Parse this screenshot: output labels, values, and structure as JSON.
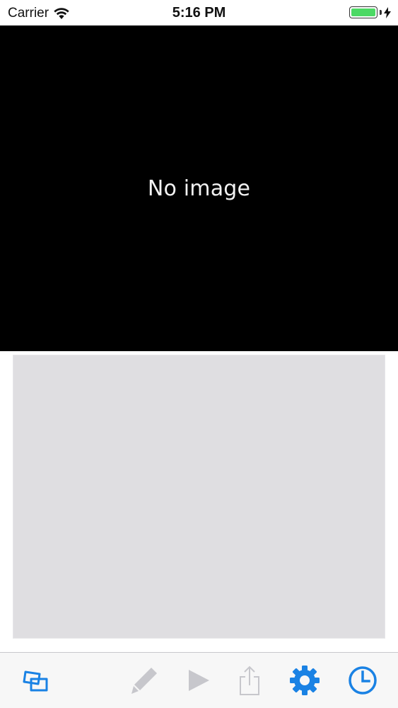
{
  "status_bar": {
    "carrier": "Carrier",
    "time": "5:16 PM",
    "battery_color": "#4cd964",
    "battery_level": 1.0
  },
  "viewer": {
    "placeholder_text": "No image"
  },
  "toolbar": {
    "accent_color": "#1a82e4",
    "disabled_color": "#c7c7cc",
    "items": [
      {
        "icon": "gallery-icon",
        "enabled": true
      },
      {
        "icon": "pencil-icon",
        "enabled": false
      },
      {
        "icon": "play-icon",
        "enabled": false
      },
      {
        "icon": "share-icon",
        "enabled": false
      },
      {
        "icon": "gear-icon",
        "enabled": true
      },
      {
        "icon": "clock-icon",
        "enabled": true
      }
    ]
  }
}
